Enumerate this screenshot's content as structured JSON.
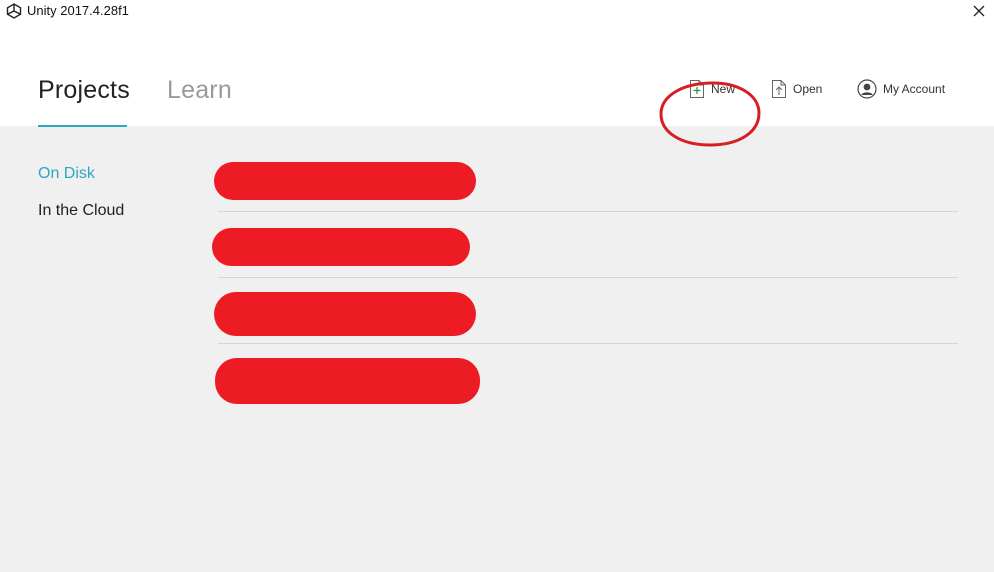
{
  "window": {
    "title": "Unity 2017.4.28f1"
  },
  "tabs": [
    {
      "label": "Projects",
      "active": true
    },
    {
      "label": "Learn",
      "active": false
    }
  ],
  "actions": {
    "new_label": "New",
    "open_label": "Open",
    "account_label": "My Account"
  },
  "sidebar": {
    "items": [
      {
        "label": "On Disk",
        "active": true
      },
      {
        "label": "In the Cloud",
        "active": false
      }
    ]
  },
  "projects": {
    "count_visible": 4,
    "names_redacted": true
  },
  "colors": {
    "accent": "#2ea6c0",
    "annotation_red": "#d81e24",
    "redaction_red": "#ed1c24",
    "background": "#f0f0f0",
    "header_bg": "#ffffff"
  },
  "icons": {
    "unity_logo": "unity-logo-icon",
    "close": "close-icon",
    "new": "new-project-icon",
    "open": "open-project-icon",
    "account": "account-icon"
  }
}
